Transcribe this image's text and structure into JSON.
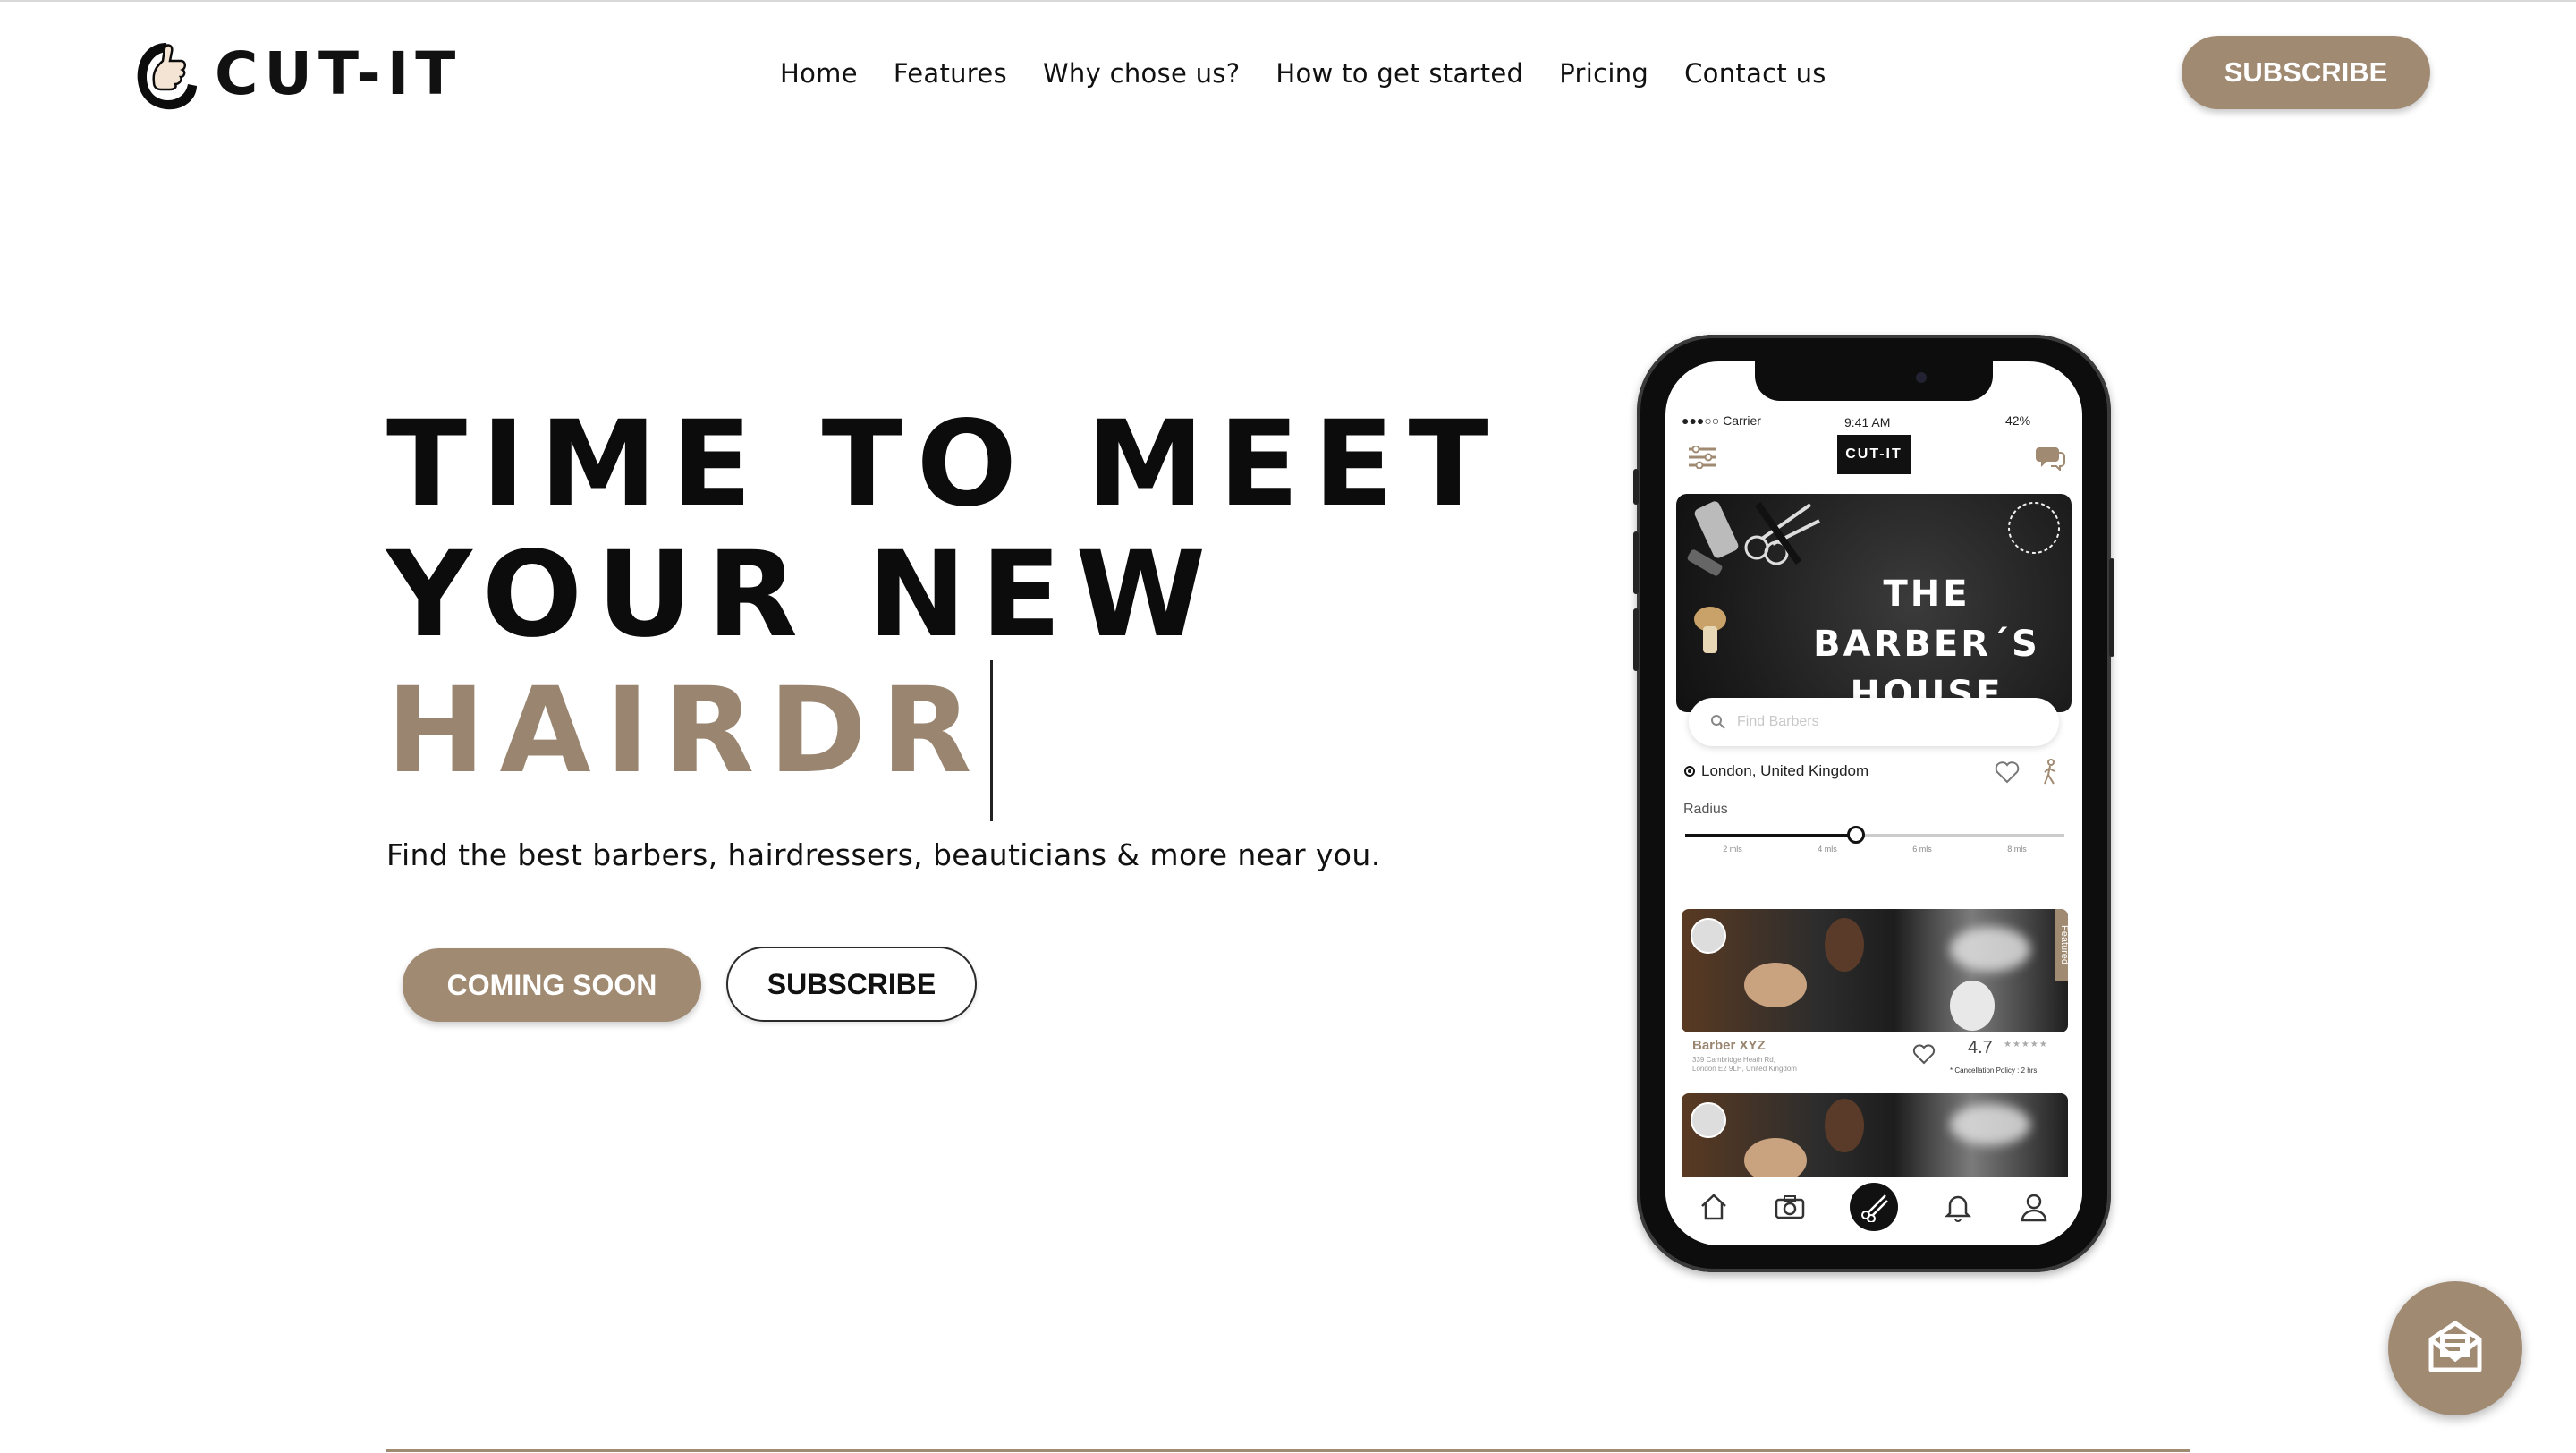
{
  "header": {
    "brand": "CUT-IT",
    "nav": [
      "Home",
      "Features",
      "Why chose us?",
      "How to get started",
      "Pricing",
      "Contact us"
    ],
    "subscribe_label": "SUBSCRIBE"
  },
  "hero": {
    "line1": "TIME TO MEET",
    "line2": "YOUR NEW",
    "line3": "HAIRDR",
    "subtitle": "Find the best barbers, hairdressers, beauticians & more near you.",
    "coming_soon_label": "COMING SOON",
    "subscribe_label": "SUBSCRIBE"
  },
  "phone": {
    "carrier": "Carrier",
    "time": "9:41 AM",
    "battery": "42%",
    "app_logo": "CUT-IT",
    "banner_line1": "THE BARBER´S",
    "banner_line2": "HOUSE",
    "search_placeholder": "Find Barbers",
    "location": "London, United Kingdom",
    "radius_label": "Radius",
    "radius_ticks": [
      "2 mls",
      "4 mls",
      "6 mls",
      "8 mls"
    ],
    "radius_value": 0.45,
    "featured_label": "Featured",
    "barber_name": "Barber XYZ",
    "barber_address": "339 Cambridge Heath Rd, London E2 9LH, United Kingdom",
    "rating": "4.7",
    "cancellation": "* Cancellation Policy : 2 hrs"
  },
  "colors": {
    "accent": "#a08a72",
    "accent_text": "#9a8670",
    "ink": "#0c0c0c"
  },
  "icons": {
    "logo": "thumbs-up-hand-logo-icon",
    "fab": "chat-envelope-icon"
  }
}
